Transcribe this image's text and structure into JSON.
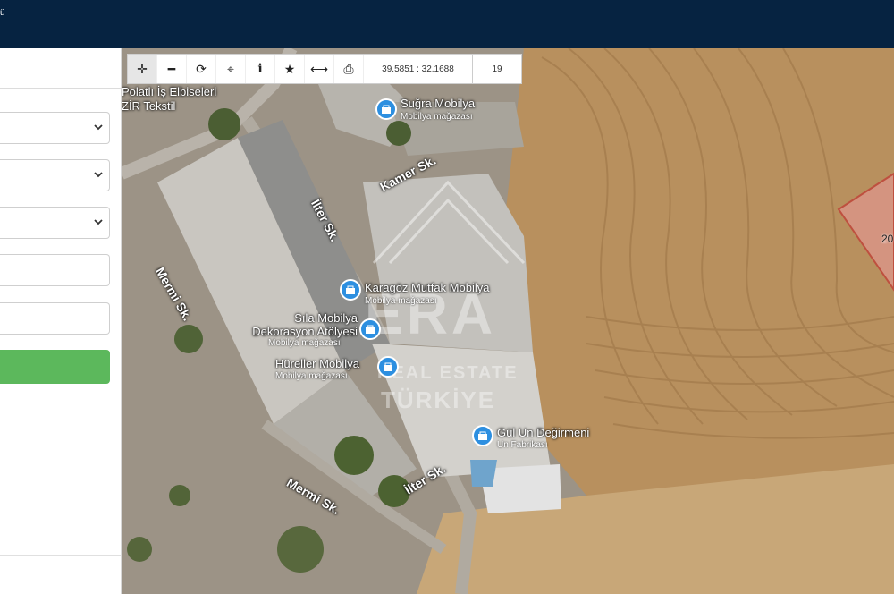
{
  "header": {
    "title_fragment": "ü"
  },
  "toolbar": {
    "tools": [
      {
        "name": "pan-icon",
        "glyph": "✛"
      },
      {
        "name": "zoom-out-icon",
        "glyph": "━"
      },
      {
        "name": "refresh-icon",
        "glyph": "⟳"
      },
      {
        "name": "locate-icon",
        "glyph": "⌖"
      },
      {
        "name": "info-icon",
        "glyph": "i"
      },
      {
        "name": "favorite-icon",
        "glyph": "★"
      },
      {
        "name": "measure-icon",
        "glyph": "⟷"
      },
      {
        "name": "print-icon",
        "glyph": "⎙"
      }
    ],
    "coordinates": "39.5851 : 32.1688",
    "zoom_level": "19"
  },
  "map": {
    "places": [
      {
        "name": "Polatlı İş Elbiseleri",
        "sub": ""
      },
      {
        "name": "ZİR Tekstil",
        "sub": ""
      },
      {
        "name": "Suğra Mobilya",
        "sub": "Mobilya mağazası"
      },
      {
        "name": "Karagöz Mutfak Mobilya",
        "sub": "Mobilya mağazası"
      },
      {
        "name": "Sıla Mobilya Dekorasyon Atölyesi",
        "sub": "Mobilya mağazası"
      },
      {
        "name": "Hüreller Mobilya",
        "sub": "Mobilya mağazası"
      },
      {
        "name": "Gül Un Değirmeni",
        "sub": "Un Fabrikası"
      }
    ],
    "streets": [
      "Kamer Sk.",
      "İlter Sk.",
      "Mermi Sk.",
      "Mermi Sk.",
      "İlter Sk."
    ],
    "watermark": {
      "brand": "ERA",
      "line1": "REAL ESTATE",
      "line2": "TÜRKİYE"
    },
    "parcel_label": "20"
  }
}
